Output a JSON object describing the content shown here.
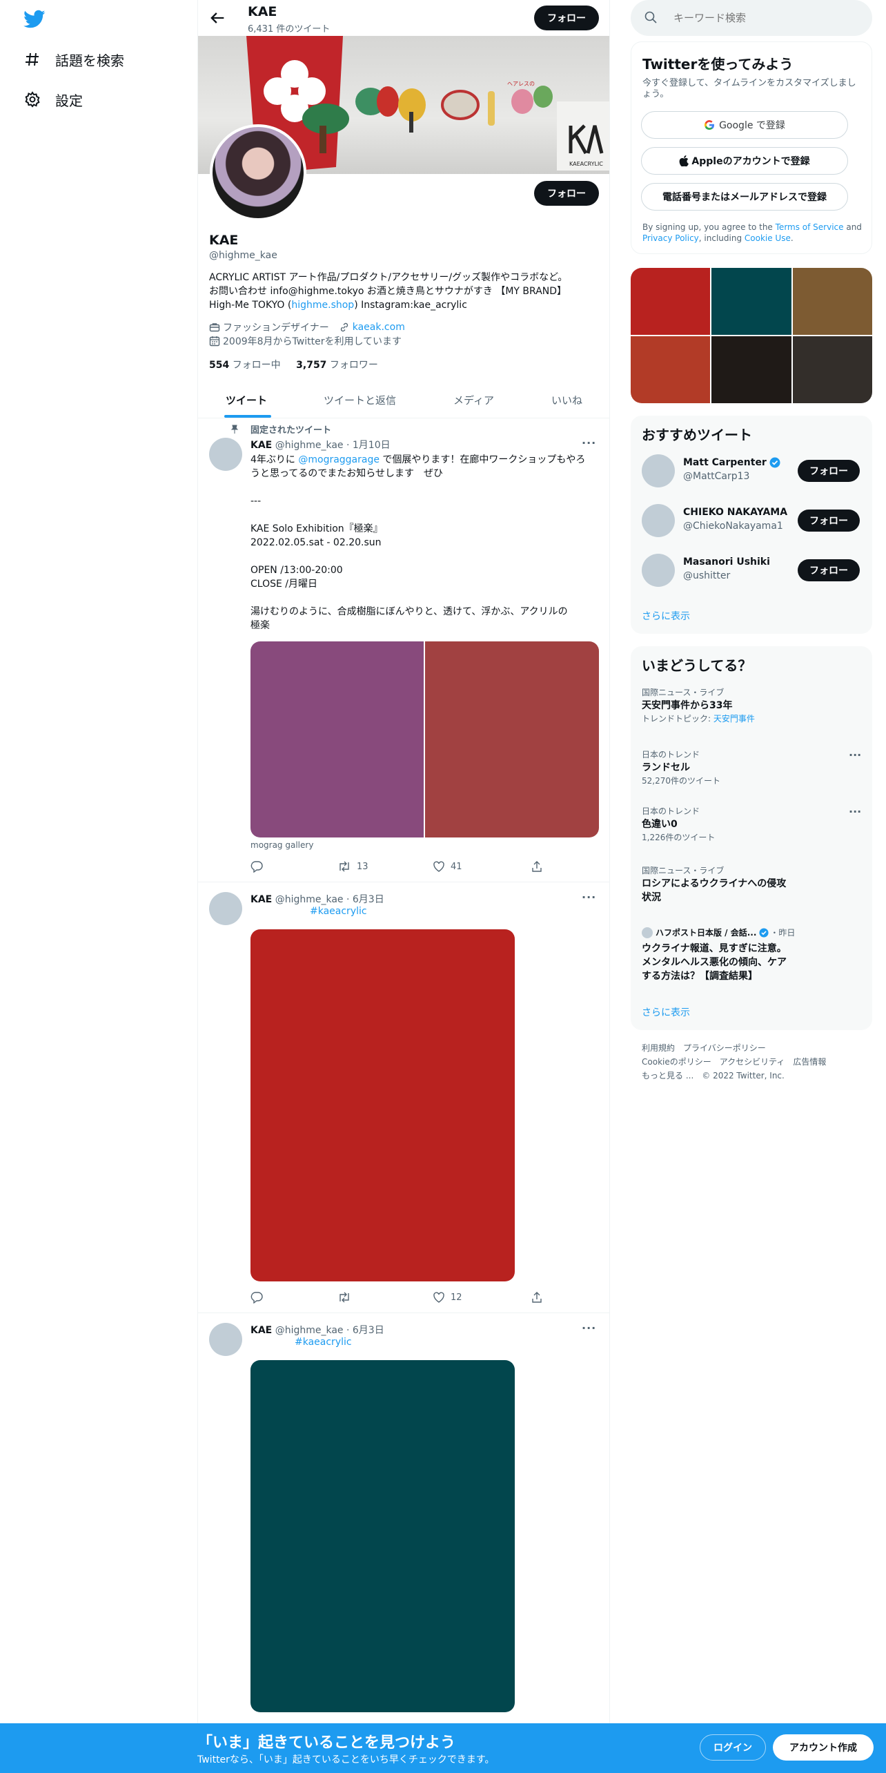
{
  "nav": {
    "explore_label": "話題を検索",
    "settings_label": "設定"
  },
  "header": {
    "name": "KAE",
    "tweet_count": "6,431 件のツイート",
    "follow_label": "フォロー"
  },
  "profile": {
    "name": "KAE",
    "handle": "@highme_kae",
    "follow_label": "フォロー",
    "bio_line1": "ACRYLIC ARTIST  アート作品/プロダクト/アクセサリー/グッズ製作やコラボなど。",
    "bio_line2": "お問い合わせ info@highme.tokyo お酒と焼き鳥とサウナがすき 【MY BRAND】",
    "bio_line3_pre": "High-Me TOKYO (",
    "bio_line3_link": "highme.shop",
    "bio_line3_post": ") Instagram:kae_acrylic",
    "profession": "ファッションデザイナー",
    "website": "kaeak.com",
    "joined": "2009年8月からTwitterを利用しています",
    "following_count": "554",
    "following_label": "フォロー中",
    "followers_count": "3,757",
    "followers_label": "フォロワー",
    "banner_text": "KAEACRYLIC"
  },
  "tabs": [
    "ツイート",
    "ツイートと返信",
    "メディア",
    "いいね"
  ],
  "tweets": [
    {
      "pinned_label": "固定されたツイート",
      "name": "KAE",
      "handle_date": "@highme_kae · 1月10日",
      "text_pre": "4年ぶりに ",
      "mention": "@mograggarage",
      "text_post": " で個展やります！在廊中ワークショップもやろ",
      "line2": "うと思ってるのでまたお知らせします　ぜひ",
      "sep": "---",
      "line_exhibition": "KAE Solo Exhibition『極楽』",
      "line_dates": "2022.02.05.sat - 02.20.sun",
      "line_open": "OPEN /13:00-20:00",
      "line_close": "CLOSE /月曜日",
      "line_desc1": "湯けむりのように、合成樹脂にぼんやりと、透けて、浮かぶ、アクリルの",
      "line_desc2": "極楽",
      "media_caption": "mograg gallery",
      "retweets": "13",
      "likes": "41",
      "media_colors": [
        "#884a7c",
        "#a14141"
      ]
    },
    {
      "name": "KAE",
      "handle_date": "@highme_kae · 6月3日",
      "hashtag": "#kaeacrylic",
      "likes": "12",
      "media_color": "#b8221f"
    },
    {
      "name": "KAE",
      "handle_date": "@highme_kae · 6月3日",
      "hashtag": "#kaeacrylic",
      "media_color": "#02464d"
    }
  ],
  "search": {
    "placeholder": "キーワード検索"
  },
  "signup": {
    "title": "Twitterを使ってみよう",
    "subtitle": "今すぐ登録して、タイムラインをカスタマイズしましょう。",
    "google_label": "Google で登録",
    "apple_label": "Appleのアカウントで登録",
    "phone_label": "電話番号またはメールアドレスで登録",
    "terms_pre": "By signing up, you agree to the ",
    "terms_link": "Terms of Service",
    "terms_mid": " and ",
    "privacy_link": "Privacy Policy",
    "terms_mid2": ", including ",
    "cookie_link": "Cookie Use",
    "terms_end": "."
  },
  "media_grid_colors": [
    "#b8221f",
    "#02464d",
    "#7d5b32",
    "#b23b27",
    "#1f1a17",
    "#332e2a"
  ],
  "recommended": {
    "title": "おすすめツイート",
    "follow_label": "フォロー",
    "users": [
      {
        "name": "Matt Carpenter",
        "handle": "@MattCarp13",
        "verified": true
      },
      {
        "name": "CHIEKO NAKAYAMA",
        "handle": "@ChiekoNakayama1",
        "verified": false
      },
      {
        "name": "Masanori Ushiki",
        "handle": "@ushitter",
        "verified": false
      }
    ],
    "show_more": "さらに表示"
  },
  "trends": {
    "title": "いまどうしてる？",
    "items": [
      {
        "category": "国際ニュース・ライブ",
        "title": "天安門事件から33年",
        "extra_pre": "トレンドトピック: ",
        "extra_link": "天安門事件"
      },
      {
        "category": "日本のトレンド",
        "title": "ランドセル",
        "count": "52,270件のツイート"
      },
      {
        "category": "日本のトレンド",
        "title": "色違い0",
        "count": "1,226件のツイート"
      },
      {
        "category": "国際ニュース・ライブ",
        "title_line1": "ロシアによるウクライナへの侵攻",
        "title_line2": "状況"
      },
      {
        "source": "ハフポスト日本版 / 会話...",
        "time": "・昨日",
        "title_line1": "ウクライナ報道、見すぎに注意。",
        "title_line2": "メンタルヘルス悪化の傾向、ケア",
        "title_line3": "する方法は？【調査結果】"
      }
    ],
    "show_more": "さらに表示"
  },
  "footer": {
    "line1": "利用規約　プライバシーポリシー",
    "line2": "Cookieのポリシー　アクセシビリティ　広告情報",
    "line3": "もっと見る ...　© 2022 Twitter, Inc."
  },
  "bottom_bar": {
    "title": "「いま」起きていることを見つけよう",
    "subtitle": "Twitterなら、「いま」起きていることをいち早くチェックできます。",
    "login_label": "ログイン",
    "signup_label": "アカウント作成"
  }
}
